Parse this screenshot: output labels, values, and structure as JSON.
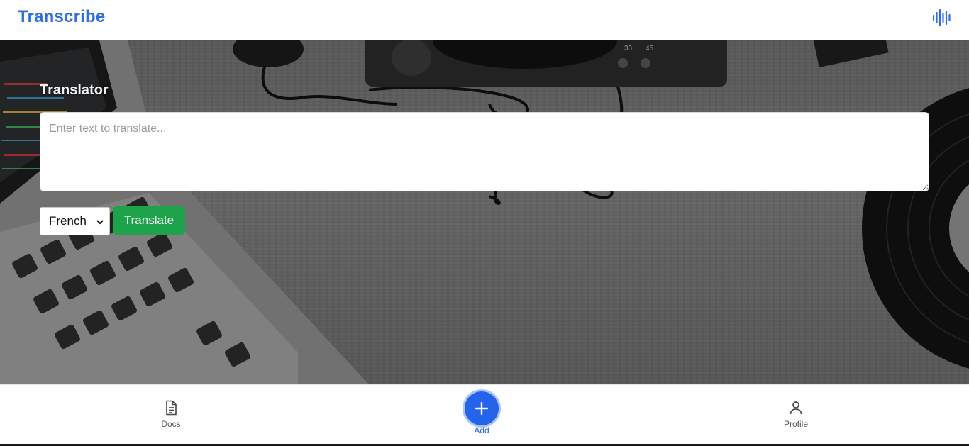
{
  "header": {
    "brand": "Transcribe",
    "icon": "audio-wave-icon"
  },
  "translator": {
    "title": "Translator",
    "input_value": "",
    "input_placeholder": "Enter text to translate...",
    "language_selected": "French",
    "translate_label": "Translate"
  },
  "bottom_nav": {
    "items": [
      {
        "label": "Docs",
        "icon": "document-icon"
      },
      {
        "label": "Add",
        "icon": "plus-icon"
      },
      {
        "label": "Profile",
        "icon": "user-icon"
      }
    ]
  },
  "colors": {
    "brand": "#2f6fe4",
    "translate_button": "#1fa34a",
    "add_button": "#2563eb",
    "add_ring": "#a9c4f8"
  }
}
